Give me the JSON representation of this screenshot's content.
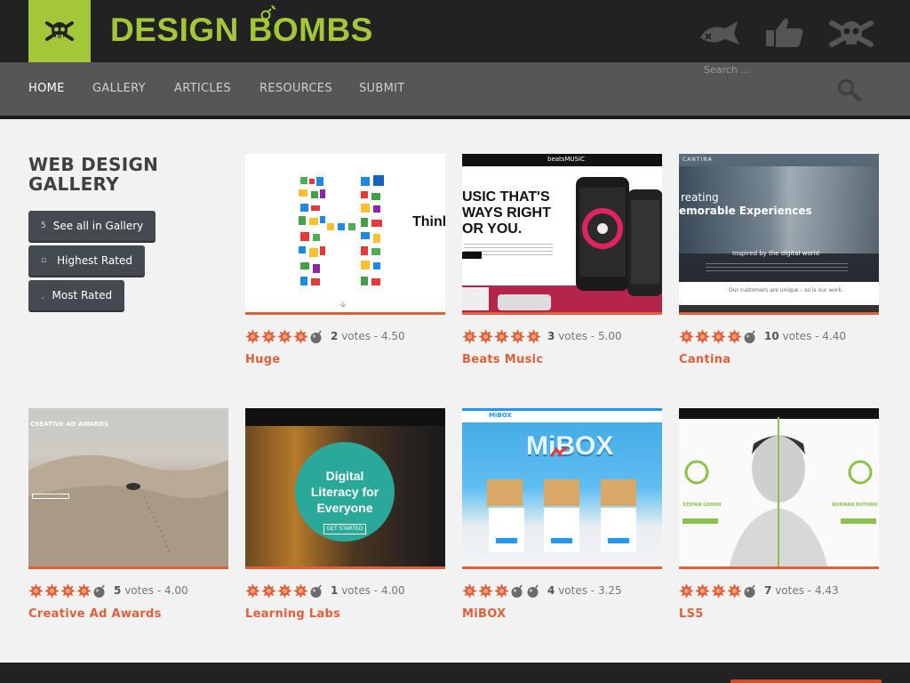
{
  "header": {
    "brand": "DESIGN BOMBS",
    "icons": [
      "skull-crossbones-icon",
      "dead-fish-icon",
      "thumbs-up-icon",
      "skull-cog-icon"
    ]
  },
  "nav": {
    "items": [
      "HOME",
      "GALLERY",
      "ARTICLES",
      "RESOURCES",
      "SUBMIT"
    ],
    "active": "HOME"
  },
  "search": {
    "placeholder": "Search ..."
  },
  "sidebar": {
    "title": "WEB DESIGN GALLERY",
    "buttons": [
      {
        "glyph": "5",
        "label": "See all in Gallery"
      },
      {
        "glyph": "▫",
        "label": "Highest Rated"
      },
      {
        "glyph": "¸",
        "label": "Most Rated"
      }
    ]
  },
  "gallery": [
    {
      "title": "Huge",
      "votes": "2",
      "votes_label": "votes",
      "score": "4.50",
      "rating": 4
    },
    {
      "title": "Beats Music",
      "votes": "3",
      "votes_label": "votes",
      "score": "5.00",
      "rating": 5
    },
    {
      "title": "Cantina",
      "votes": "10",
      "votes_label": "votes",
      "score": "4.40",
      "rating": 4
    },
    {
      "title": "Creative Ad Awards",
      "votes": "5",
      "votes_label": "votes",
      "score": "4.00",
      "rating": 4
    },
    {
      "title": "Learning Labs",
      "votes": "1",
      "votes_label": "votes",
      "score": "4.00",
      "rating": 4
    },
    {
      "title": "MiBOX",
      "votes": "4",
      "votes_label": "votes",
      "score": "3.25",
      "rating": 3
    },
    {
      "title": "LS5",
      "votes": "7",
      "votes_label": "votes",
      "score": "4.43",
      "rating": 4
    }
  ],
  "thumb_text": {
    "huge": "Think",
    "beats_brand": "beatsMUSIC",
    "beats_headline_1": "USIC THAT'S",
    "beats_headline_2": "WAYS RIGHT",
    "beats_headline_3": "OR YOU.",
    "cantina_brand": "CANTINA",
    "cantina_1": "reating",
    "cantina_2": "emorable Experiences",
    "cantina_3": "Inspired by the digital world",
    "cantina_4": "Our customers are unique – so is our work.",
    "ad_awards": "CREATIVE AD AWARDS",
    "ll_1": "Digital",
    "ll_2": "Literacy for",
    "ll_3": "Everyone",
    "ll_btn": "GET STARTED",
    "mibox": "MiBOX",
    "mibox_big": "MiBOX",
    "ls5_left": "STEFAN GERHM",
    "ls5_right": "NORMAN ROTHMU"
  },
  "colors": {
    "accent": "#e0603a",
    "logo_green": "#a4c639",
    "nav_bg": "#565656",
    "header_bg": "#222222",
    "button_bg": "#444b50"
  }
}
